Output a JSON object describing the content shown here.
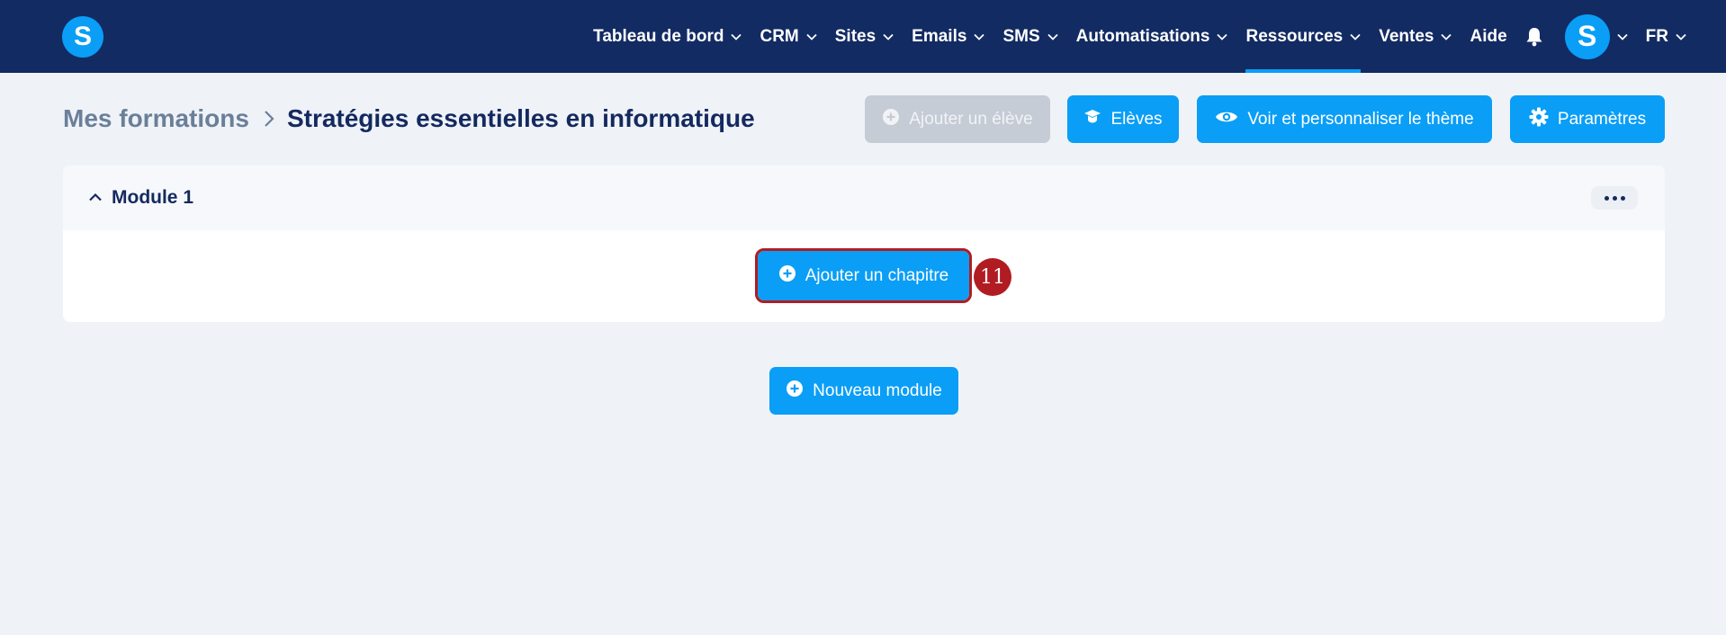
{
  "header": {
    "logo_letter": "S",
    "nav": [
      {
        "label": "Tableau de bord",
        "has_dropdown": true
      },
      {
        "label": "CRM",
        "has_dropdown": true
      },
      {
        "label": "Sites",
        "has_dropdown": true
      },
      {
        "label": "Emails",
        "has_dropdown": true
      },
      {
        "label": "SMS",
        "has_dropdown": true
      },
      {
        "label": "Automatisations",
        "has_dropdown": true
      },
      {
        "label": "Ressources",
        "has_dropdown": true,
        "active": true
      },
      {
        "label": "Ventes",
        "has_dropdown": true
      },
      {
        "label": "Aide",
        "has_dropdown": false
      }
    ],
    "avatar_letter": "S",
    "language": "FR"
  },
  "breadcrumb": {
    "parent": "Mes formations",
    "current": "Stratégies essentielles en informatique"
  },
  "toolbar": {
    "add_student": "Ajouter un élève",
    "students": "Elèves",
    "theme": "Voir et personnaliser le thème",
    "settings": "Paramètres"
  },
  "module": {
    "title": "Module 1",
    "add_chapter": "Ajouter un chapitre"
  },
  "step_badge": "11",
  "new_module": "Nouveau module",
  "colors": {
    "topbar": "#132b63",
    "accent": "#0a9ef6",
    "highlight": "#b01c22",
    "disabled": "#c6ccd6",
    "background": "#eff3f8"
  }
}
